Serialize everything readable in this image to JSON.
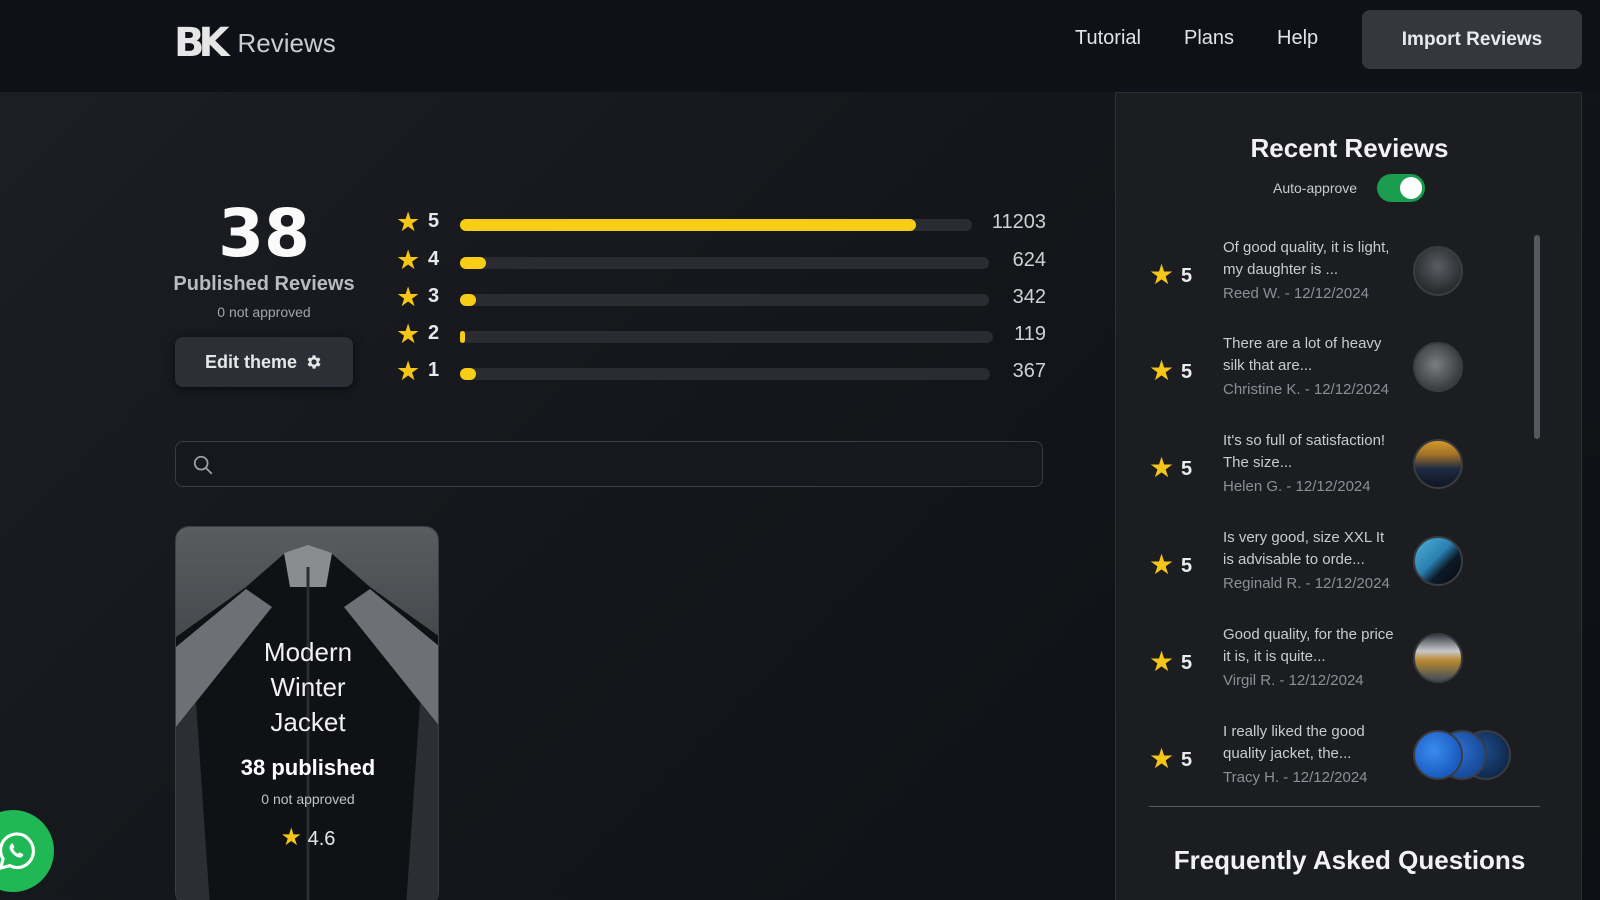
{
  "header": {
    "logo_mark": "BK",
    "logo_text": "Reviews",
    "nav": [
      {
        "label": "Tutorial"
      },
      {
        "label": "Plans"
      },
      {
        "label": "Help"
      }
    ],
    "import_label": "Import Reviews"
  },
  "summary": {
    "count": "38",
    "published_label": "Published Reviews",
    "not_approved": "0 not approved",
    "edit_theme_label": "Edit theme",
    "edit_theme_icon": "gear-icon"
  },
  "ratings": [
    {
      "stars": "5",
      "count": "11203",
      "fraction": 0.89
    },
    {
      "stars": "4",
      "count": "624",
      "fraction": 0.05
    },
    {
      "stars": "3",
      "count": "342",
      "fraction": 0.03
    },
    {
      "stars": "2",
      "count": "119",
      "fraction": 0.01
    },
    {
      "stars": "1",
      "count": "367",
      "fraction": 0.03
    }
  ],
  "search": {
    "placeholder": "",
    "icon": "search-icon"
  },
  "product": {
    "name": "Modern\nWinter\nJacket",
    "published": "38 published",
    "not_approved": "0 not approved",
    "rating": "4.6"
  },
  "sidebar": {
    "title": "Recent Reviews",
    "auto_approve_label": "Auto-approve",
    "auto_approve_on": true,
    "reviews": [
      {
        "rating": "5",
        "text": "Of good quality, it is light, my daughter is ...",
        "meta": "Reed W. - 12/12/2024"
      },
      {
        "rating": "5",
        "text": "There are a lot of heavy silk that are...",
        "meta": "Christine K. - 12/12/2024"
      },
      {
        "rating": "5",
        "text": "It's so full of satisfaction! The size...",
        "meta": "Helen G. - 12/12/2024"
      },
      {
        "rating": "5",
        "text": "Is very good, size XXL It is advisable to orde...",
        "meta": "Reginald R. - 12/12/2024"
      },
      {
        "rating": "5",
        "text": "Good quality, for the price it is, it is quite...",
        "meta": "Virgil R. - 12/12/2024"
      },
      {
        "rating": "5",
        "text": "I really liked the good quality jacket, the...",
        "meta": "Tracy H. - 12/12/2024"
      }
    ],
    "faq_title": "Frequently Asked Questions"
  },
  "colors": {
    "star": "#f5c518",
    "bar_fill": "#f7cd16",
    "toggle_on": "#1a9c4e",
    "whatsapp": "#1fb855"
  }
}
